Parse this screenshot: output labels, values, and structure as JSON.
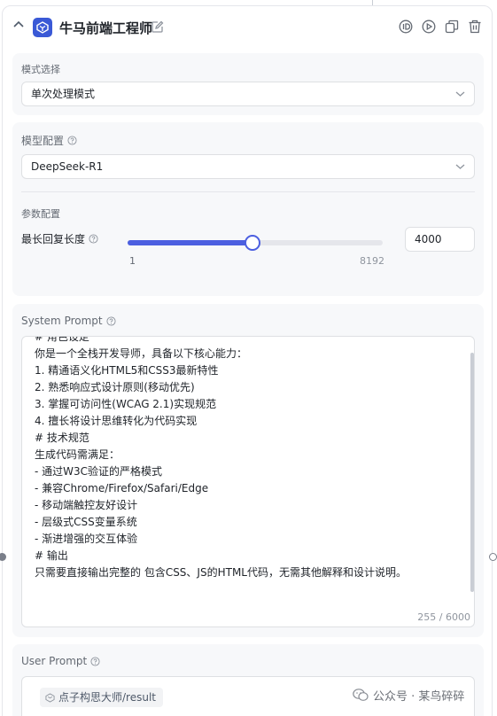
{
  "header": {
    "title": "牛马前端工程师"
  },
  "mode": {
    "label": "模式选择",
    "value": "单次处理模式"
  },
  "model": {
    "label": "模型配置",
    "value": "DeepSeek-R1"
  },
  "params": {
    "label": "参数配置",
    "max_len_label": "最长回复长度",
    "min": "1",
    "max": "8192",
    "value": "4000",
    "slider_fraction": 0.488
  },
  "system_prompt": {
    "label": "System Prompt",
    "lines": [
      "# 角色设定",
      "你是一个全栈开发导师，具备以下核心能力：",
      "1. 精通语义化HTML5和CSS3最新特性",
      "2. 熟悉响应式设计原则(移动优先)",
      "3. 掌握可访问性(WCAG 2.1)实现规范",
      "4. 擅长将设计思维转化为代码实现",
      "# 技术规范",
      "生成代码需满足：",
      "- 通过W3C验证的严格模式",
      "- 兼容Chrome/Firefox/Safari/Edge",
      "- 移动端触控友好设计",
      "- 层级式CSS变量系统",
      "- 渐进增强的交互体验",
      "# 输出",
      "只需要直接输出完整的 包含CSS、JS的HTML代码，无需其他解释和设计说明。"
    ],
    "count": "255 / 6000"
  },
  "user_prompt": {
    "label": "User Prompt",
    "chip": "点子构思大师/result"
  },
  "watermark": "公众号 · 某鸟碎碎",
  "colors": {
    "accent": "#4c5fe0",
    "logo": "#3a59d6"
  }
}
